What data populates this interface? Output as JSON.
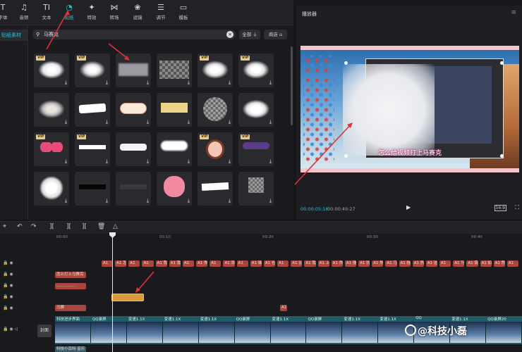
{
  "toolbar": {
    "tools": [
      {
        "name": "text-style",
        "label": "字体",
        "icon": "T"
      },
      {
        "name": "audio",
        "label": "音频",
        "icon": "♫"
      },
      {
        "name": "text",
        "label": "文本",
        "icon": "TI"
      },
      {
        "name": "sticker",
        "label": "贴纸",
        "icon": "◔"
      },
      {
        "name": "effects",
        "label": "特效",
        "icon": "✦"
      },
      {
        "name": "transition",
        "label": "转场",
        "icon": "⋈"
      },
      {
        "name": "filter",
        "label": "滤镜",
        "icon": "❀"
      },
      {
        "name": "adjust",
        "label": "调节",
        "icon": "☰"
      },
      {
        "name": "template",
        "label": "模板",
        "icon": "▭"
      }
    ],
    "active": "sticker"
  },
  "sidebar": {
    "items": [
      {
        "label": "贴纸素材"
      }
    ]
  },
  "search": {
    "value": "马赛克",
    "all_label": "全部",
    "store_label": "商店"
  },
  "player": {
    "title": "播放器",
    "caption": "怎么给视频打上马赛克",
    "time_current": "00:00:05:16",
    "time_total": "00:00:49:27",
    "ratio": "16:9"
  },
  "ruler": {
    "marks": [
      "00:00",
      "00:10",
      "00:20",
      "00:30",
      "00:40"
    ]
  },
  "tracks": {
    "text_row1": [
      "A1",
      "A1 怎么",
      "A1",
      "A1",
      "A1 我",
      "A1 我们",
      "A1",
      "A1 然后",
      "A1",
      "A1 添加",
      "A1",
      "A1 编辑",
      "A1 也可",
      "A1",
      "A1 比方",
      "A1 我们",
      "A1 上",
      "A1 然后",
      "A1 搜索",
      "A1 找",
      "A1 然后",
      "A1 马赛",
      "A1 拖动",
      "A1 然后",
      "A1 这里",
      "A1",
      "A1 可以",
      "A1 需要",
      "A1 如",
      "A1 然后",
      "A1"
    ],
    "text_row2": "怎么打上马赛克",
    "text_row3": "...............",
    "text_row4": "马赛",
    "text_row4b": "A1",
    "video_clips": [
      "科技进步界面",
      "QQ录屏",
      "变速1.1X",
      "变速1.1X",
      "变速1.1X",
      "QQ录屏",
      "变速1.1X",
      "QQ录屏",
      "变速1.1X",
      "变速1.1X",
      "QQ",
      "变速1.1X",
      "QQ录屏20"
    ],
    "cover_label": "封面",
    "bottom_clip": "科技小百科 音乐"
  },
  "watermark": "@科技小磊",
  "colors": {
    "accent": "#27c4d8",
    "clip": "#a8453c",
    "sticker_clip": "#d99a3c",
    "video_track": "#1f5a66",
    "arrow": "#e0303a"
  }
}
